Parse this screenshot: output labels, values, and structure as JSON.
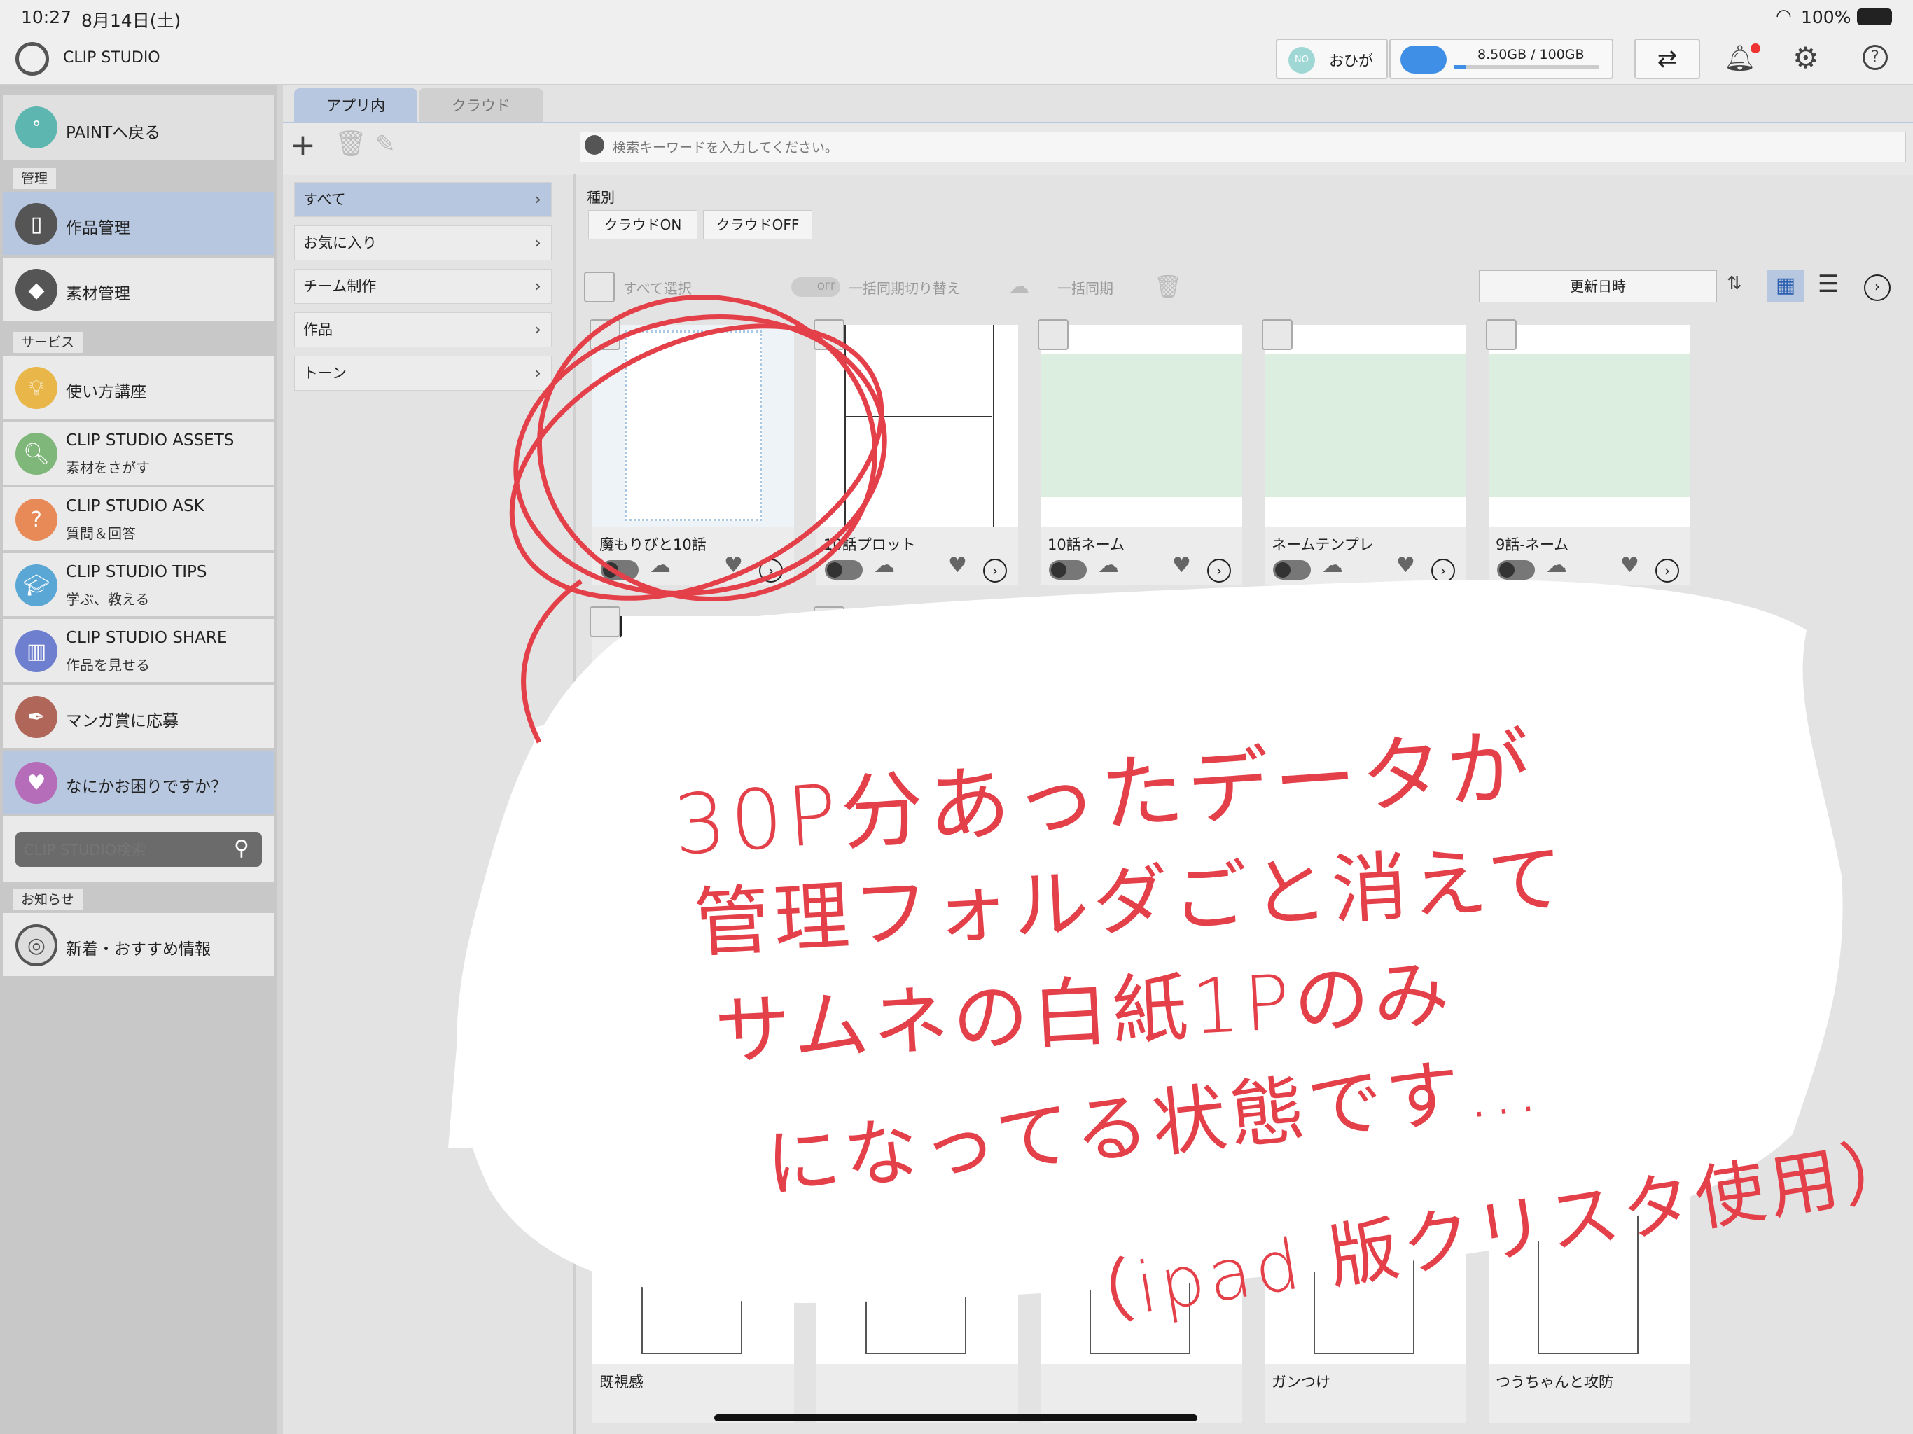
{
  "status_bar": {
    "time": "10:27",
    "date": "8月14日(土)",
    "battery": "100%"
  },
  "header": {
    "app_name": "CLIP STUDIO",
    "user_initials": "NO",
    "user_name": "おひが",
    "storage": "8.50GB / 100GB",
    "storage_fraction": 0.085
  },
  "sidebar": {
    "back": "PAINTへ戻る",
    "section_manage": "管理",
    "works": "作品管理",
    "materials": "素材管理",
    "section_service": "サービス",
    "services": [
      {
        "label": "使い方講座",
        "sub": ""
      },
      {
        "label": "CLIP STUDIO ASSETS",
        "sub": "素材をさがす"
      },
      {
        "label": "CLIP STUDIO ASK",
        "sub": "質問＆回答"
      },
      {
        "label": "CLIP STUDIO TIPS",
        "sub": "学ぶ、教える"
      },
      {
        "label": "CLIP STUDIO SHARE",
        "sub": "作品を見せる"
      },
      {
        "label": "マンガ賞に応募",
        "sub": ""
      },
      {
        "label": "なにかお困りですか？",
        "sub": ""
      }
    ],
    "search_placeholder": "CLIP STUDIO検索",
    "section_news": "お知らせ",
    "news": "新着・おすすめ情報"
  },
  "tabs": [
    "アプリ内",
    "クラウド"
  ],
  "search_placeholder": "検索キーワードを入力してください。",
  "folders": [
    "すべて",
    "お気に入り",
    "チーム制作",
    "作品",
    "トーン"
  ],
  "filter": {
    "label": "種別",
    "chips": [
      "クラウドON",
      "クラウドOFF"
    ]
  },
  "toolbar": {
    "select_all": "すべて選択",
    "toggle_off": "OFF",
    "batch_toggle": "一括同期切り替え",
    "batch_sync": "一括同期",
    "sort": "更新日時"
  },
  "works_row1": [
    "魔もりびと10話",
    "10話プロット",
    "10話ネーム",
    "ネームテンプレ",
    "9話-ネーム"
  ],
  "works_row3": [
    "既視感",
    "",
    "",
    "ガンつけ",
    "つうちゃんと攻防"
  ],
  "annotation": {
    "lines": [
      "30P分あったデータが",
      "管理フォルダごと消えて",
      "サムネの白紙1Pのみ",
      "になってる状態です…",
      "（ipad 版クリスタ使用）"
    ]
  },
  "colors": {
    "accent_red": "#e4404a",
    "selected_bg": "#b7c7df"
  }
}
